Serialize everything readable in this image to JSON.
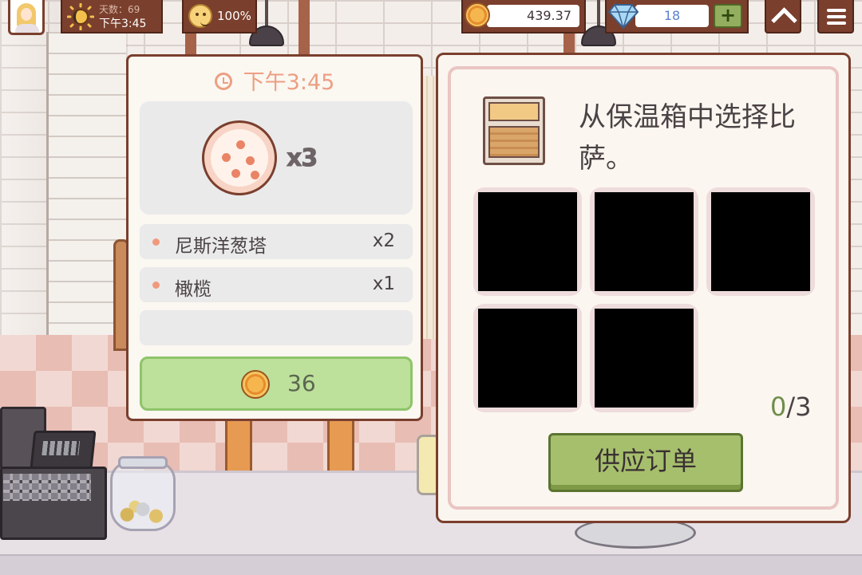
{
  "hud": {
    "day_label": "天数：69",
    "time": "下午3:45",
    "mood": "100%",
    "coins": "439.37",
    "gems": "18",
    "plus_label": "+"
  },
  "order": {
    "time": "下午3:45",
    "pizza_quantity": "x3",
    "toppings": [
      {
        "name": "尼斯洋葱塔",
        "quantity": "x2"
      },
      {
        "name": "橄榄",
        "quantity": "x1"
      }
    ],
    "reward": "36"
  },
  "warmer": {
    "title": "从保温箱中选择比萨。",
    "slots_selected": "0",
    "slots_total": "/3",
    "serve_label": "供应订单"
  },
  "icons": {
    "avatar": "chef-avatar-icon",
    "day": "sun-moon-icon",
    "mood": "smiley-face-icon",
    "coin": "coin-icon",
    "gem": "diamond-icon",
    "up": "chevron-up-icon",
    "menu": "hamburger-menu-icon",
    "clock": "clock-icon",
    "pizza": "pizza-icon",
    "warmer": "pizza-warmer-icon"
  },
  "colors": {
    "hud_brown": "#7a3f2d",
    "accent_salmon": "#ec9f83",
    "reward_green": "#bde09b",
    "serve_green": "#a6bf6d"
  }
}
